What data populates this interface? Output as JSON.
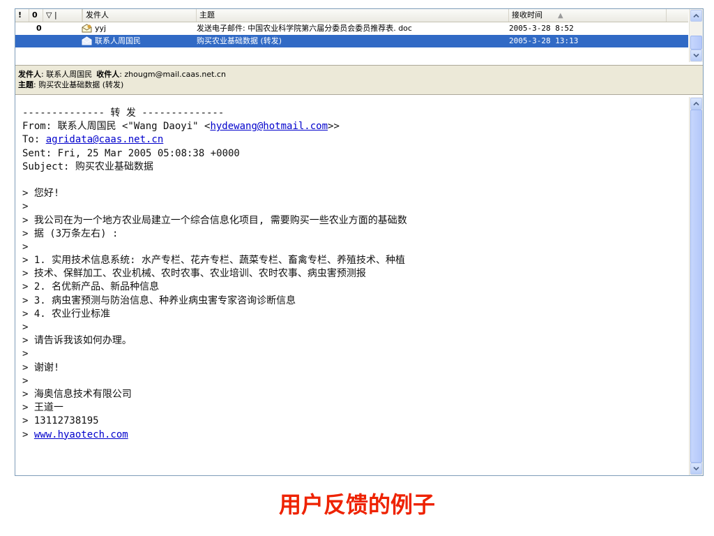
{
  "list": {
    "columns": {
      "importance": "!",
      "attachment": "0",
      "flag": "▽ |",
      "from": "发件人",
      "subject": "主题",
      "received": "接收时间",
      "sort_indicator": "▲"
    },
    "rows": [
      {
        "attachment": "0",
        "from": "yyj",
        "subject": "发送电子邮件: 中国农业科学院第六届分委员会委员推荐表. doc",
        "received": "2005-3-28 8:52",
        "selected": false
      },
      {
        "attachment": "",
        "from": "联系人周国民",
        "subject": "购买农业基础数据 (转发)",
        "received": "2005-3-28 13:13",
        "selected": true
      }
    ]
  },
  "preview_header": {
    "from_label": "发件人",
    "from_value": "联系人周国民",
    "to_label": "收件人",
    "to_value": "zhougm@mail.caas.net.cn",
    "subject_label": "主题",
    "subject_value": "购买农业基础数据 (转发)"
  },
  "message": {
    "forward_divider": "-------------- 转 发 --------------",
    "from_prefix": "From: 联系人周国民 <\"Wang Daoyi\" <",
    "from_email": "hydewang@hotmail.com",
    "from_suffix": ">>",
    "to_prefix": "To: ",
    "to_email": "agridata@caas.net.cn",
    "sent": "Sent: Fri, 25 Mar 2005 05:08:38 +0000",
    "subject": "Subject: 购买农业基础数据",
    "quoted": [
      "> 您好!",
      ">",
      "> 我公司在为一个地方农业局建立一个综合信息化项目, 需要购买一些农业方面的基础数",
      "> 据 (3万条左右) :",
      ">",
      "> 1. 实用技术信息系统: 水产专栏、花卉专栏、蔬菜专栏、畜禽专栏、养殖技术、种植",
      "> 技术、保鲜加工、农业机械、农时农事、农业培训、农时农事、病虫害预测报",
      "> 2. 名优新产品、新品种信息",
      "> 3. 病虫害预测与防治信息、种养业病虫害专家咨询诊断信息",
      "> 4. 农业行业标准",
      ">",
      "> 请告诉我该如何办理。",
      ">",
      "> 谢谢!",
      ">",
      "> 海奥信息技术有限公司",
      "> 王道一",
      "> 13112738195"
    ],
    "website_prefix": "> ",
    "website": "www.hyaotech.com"
  },
  "caption": "用户反馈的例子",
  "colors": {
    "selection": "#316ac5",
    "header_bg": "#ece9d8",
    "link": "#0000cc",
    "caption": "#ee2200",
    "scrollbar": "#c6d6fc"
  },
  "icons": [
    "envelope-read-icon",
    "envelope-selected-icon",
    "scroll-up-icon",
    "scroll-down-icon"
  ]
}
